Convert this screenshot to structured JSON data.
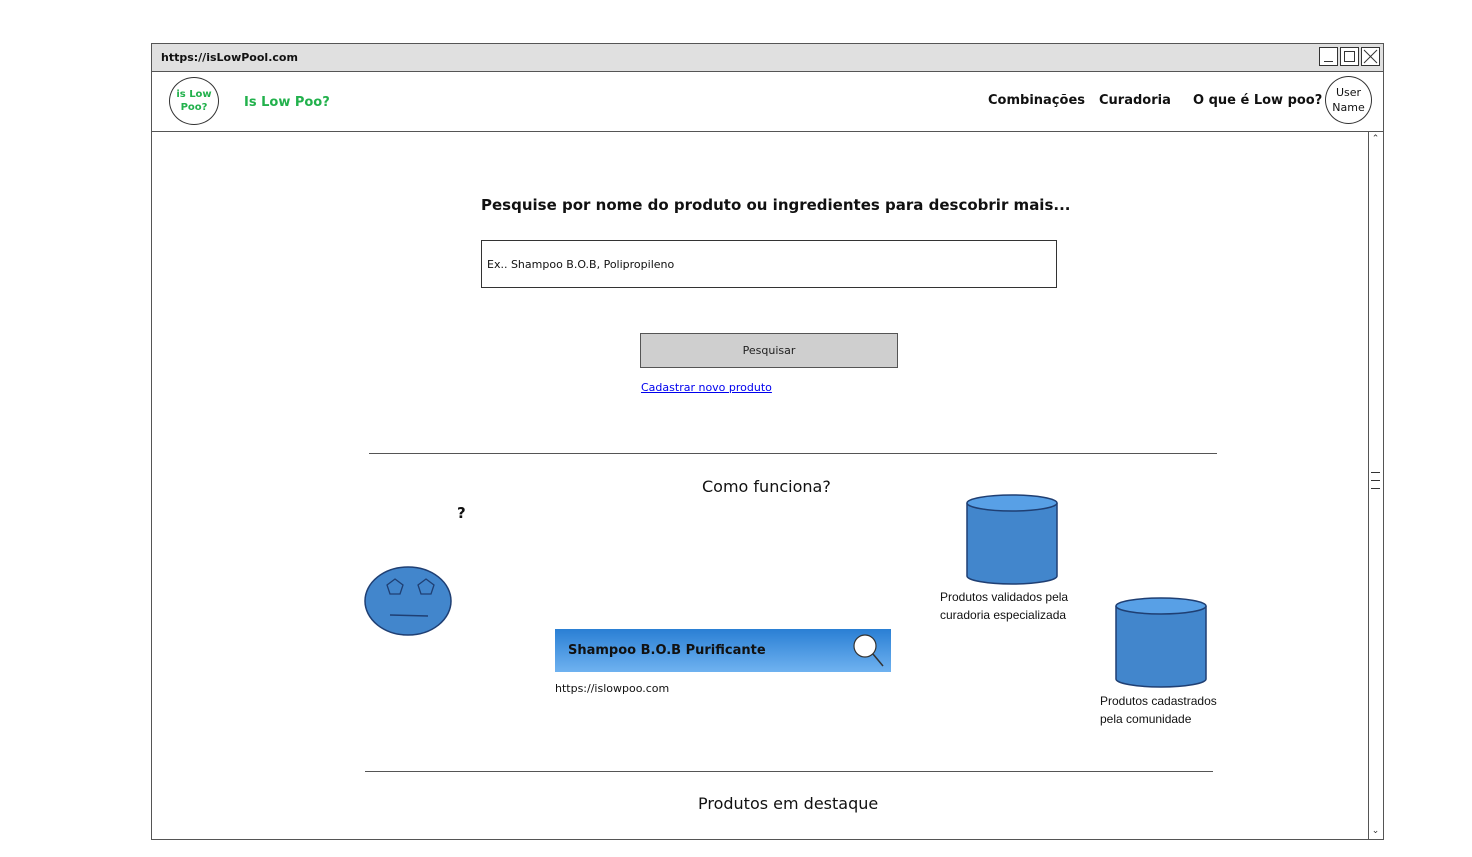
{
  "browser": {
    "url": "https://isLowPool.com"
  },
  "navbar": {
    "logo_text": "is Low Poo?",
    "brand": "Is Low Poo?",
    "links": [
      "Combinações",
      "Curadoria",
      "O que é Low poo?"
    ],
    "user": "User Name"
  },
  "search": {
    "title": "Pesquise por nome do produto ou ingredientes para descobrir mais...",
    "placeholder": "Ex.. Shampoo B.O.B, Polipropileno",
    "button_label": "Pesquisar",
    "register_link": "Cadastrar novo produto"
  },
  "how_it_works": {
    "title": "Como funciona?",
    "question_mark": "?",
    "example_result": {
      "title": "Shampoo B.O.B Purificante",
      "url": "https://islowpoo.com"
    },
    "databases": [
      {
        "line1": "Produtos validados pela",
        "line2": "curadoria especializada"
      },
      {
        "line1": "Produtos cadastrados",
        "line2": "pela comunidade"
      }
    ]
  },
  "featured": {
    "title": "Produtos em destaque"
  },
  "colors": {
    "brand_green": "#22b14c",
    "db_blue": "#4286cc",
    "link_blue": "#0000ee",
    "result_bar_top": "#2a7fd4",
    "result_bar_bottom": "#6fb2f0"
  }
}
